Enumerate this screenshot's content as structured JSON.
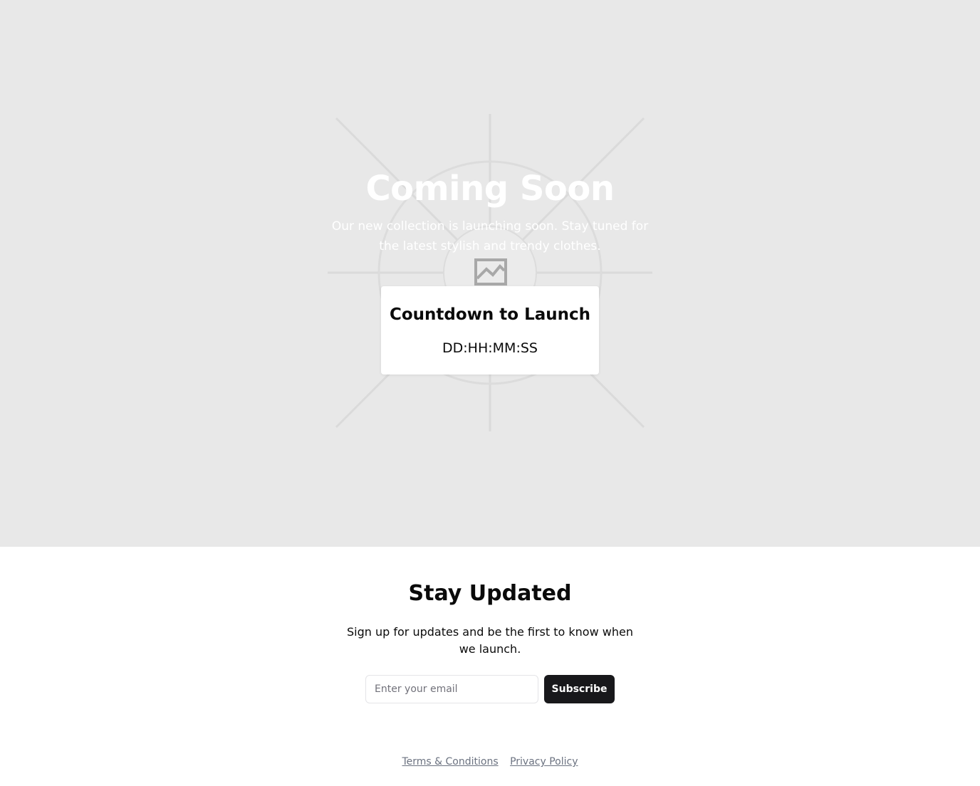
{
  "hero": {
    "title": "Coming Soon",
    "subtitle": "Our new collection is launching soon. Stay tuned for the latest stylish and trendy clothes.",
    "background_color": "#e8e8e8",
    "placeholder_icon": "image-placeholder-icon"
  },
  "countdown": {
    "title": "Countdown to Launch",
    "value": "DD:HH:MM:SS"
  },
  "subscribe": {
    "title": "Stay Updated",
    "text": "Sign up for updates and be the first to know when we launch.",
    "email_placeholder": "Enter your email",
    "button_label": "Subscribe",
    "button_color": "#18181b"
  },
  "footer": {
    "links": [
      {
        "label": "Terms & Conditions"
      },
      {
        "label": "Privacy Policy"
      }
    ],
    "link_color": "#6b7280"
  }
}
